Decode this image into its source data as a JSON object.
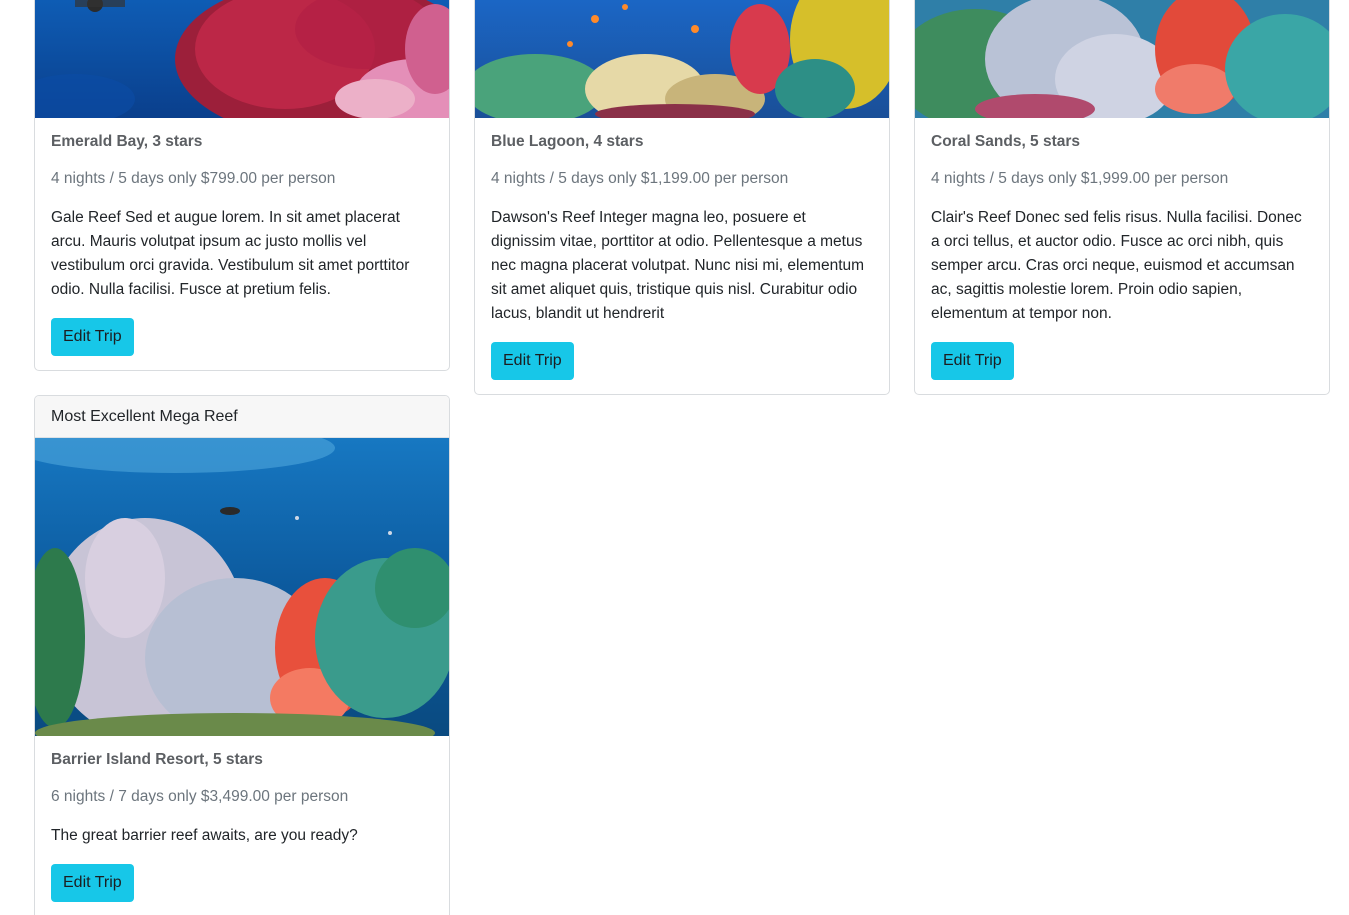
{
  "trips": [
    {
      "resort": "Emerald Bay, 3 stars",
      "price": "4 nights / 5 days only $799.00 per person",
      "description": "Gale Reef Sed et augue lorem. In sit amet placerat arcu. Mauris volutpat ipsum ac justo mollis vel vestibulum orci gravida. Vestibulum sit amet porttitor odio. Nulla facilisi. Fusce at pretium felis.",
      "button": "Edit Trip"
    },
    {
      "resort": "Blue Lagoon, 4 stars",
      "price": "4 nights / 5 days only $1,199.00 per person",
      "description": "Dawson's Reef Integer magna leo, posuere et dignissim vitae, porttitor at odio. Pellentesque a metus nec magna placerat volutpat. Nunc nisi mi, elementum sit amet aliquet quis, tristique quis nisl. Curabitur odio lacus, blandit ut hendrerit",
      "button": "Edit Trip"
    },
    {
      "resort": "Coral Sands, 5 stars",
      "price": "4 nights / 5 days only $1,999.00 per person",
      "description": "Clair's Reef Donec sed felis risus. Nulla facilisi. Donec a orci tellus, et auctor odio. Fusce ac orci nibh, quis semper arcu. Cras orci neque, euismod et accumsan ac, sagittis molestie lorem. Proin odio sapien, elementum at tempor non.",
      "button": "Edit Trip"
    },
    {
      "header": "Most Excellent Mega Reef",
      "resort": "Barrier Island Resort, 5 stars",
      "price": "6 nights / 7 days only $3,499.00 per person",
      "description": "The great barrier reef awaits, are you ready?",
      "button": "Edit Trip"
    }
  ],
  "colors": {
    "button": "#17c7e8",
    "card_border": "#d9dcdf",
    "header_bg": "#f7f7f7"
  }
}
